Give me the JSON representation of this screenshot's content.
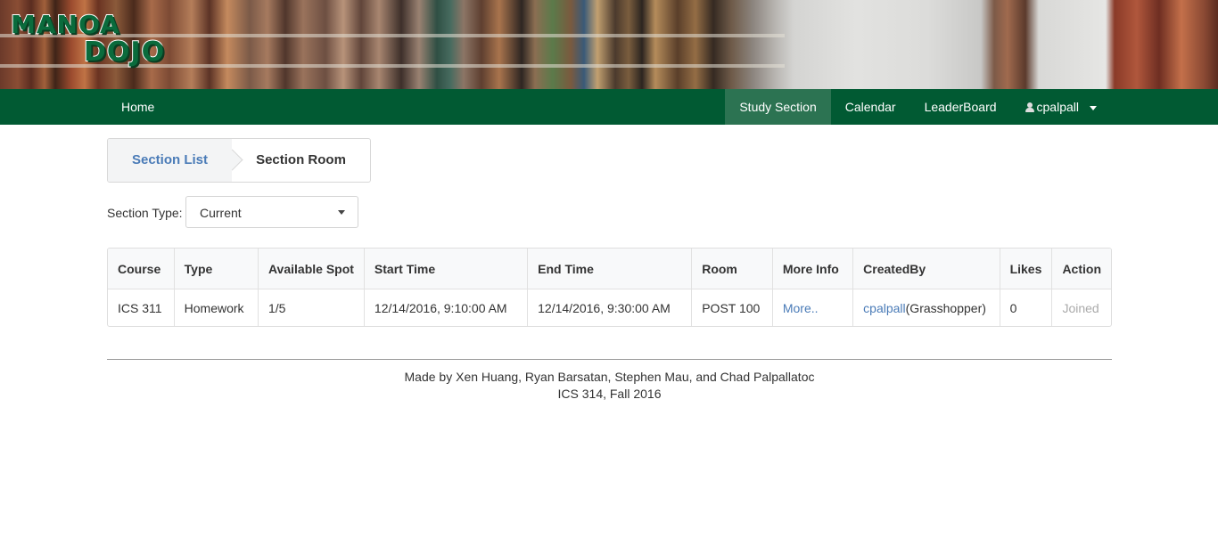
{
  "brand": {
    "line1": "Manoa",
    "line2": "Dojo"
  },
  "nav": {
    "home": "Home",
    "items": [
      {
        "label": "Study Section",
        "active": true
      },
      {
        "label": "Calendar",
        "active": false
      },
      {
        "label": "LeaderBoard",
        "active": false
      }
    ],
    "user": "cpalpall"
  },
  "steps": {
    "list": "Section List",
    "room": "Section Room"
  },
  "filter": {
    "label": "Section Type:",
    "value": "Current"
  },
  "table": {
    "headers": [
      "Course",
      "Type",
      "Available Spot",
      "Start Time",
      "End Time",
      "Room",
      "More Info",
      "CreatedBy",
      "Likes",
      "Action"
    ],
    "rows": [
      {
        "course": "ICS 311",
        "type": "Homework",
        "spot": "1/5",
        "start": "12/14/2016, 9:10:00 AM",
        "end": "12/14/2016, 9:30:00 AM",
        "room": "POST 100",
        "more": "More..",
        "creator": "cpalpall",
        "creator_rank": "(Grasshopper)",
        "likes": "0",
        "action": "Joined"
      }
    ]
  },
  "footer": {
    "line1": "Made by Xen Huang, Ryan Barsatan, Stephen Mau, and Chad Palpallatoc",
    "line2": "ICS 314, Fall 2016"
  },
  "colors": {
    "nav": "#015a33",
    "nav_active": "#2c7352",
    "link": "#4a7bb7"
  }
}
